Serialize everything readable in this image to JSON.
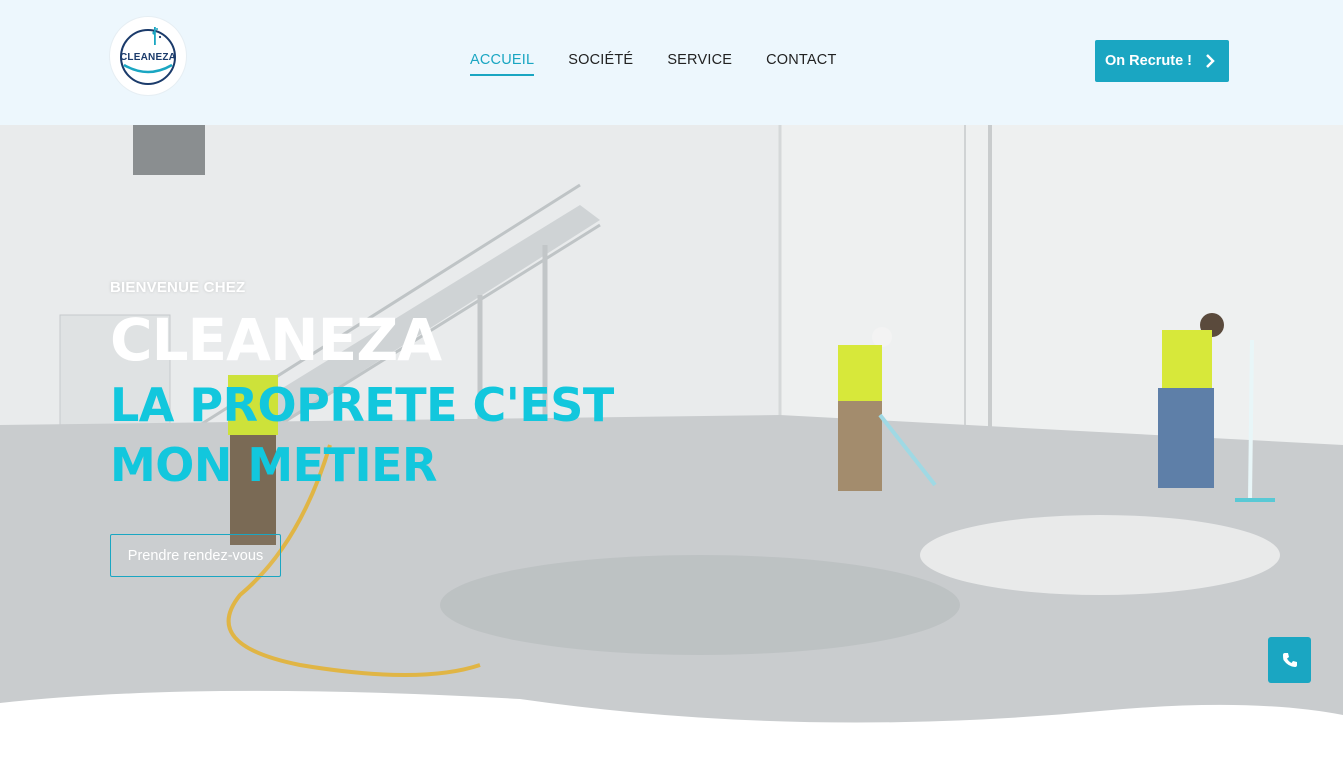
{
  "header": {
    "logo_text": "CLEANEZA",
    "nav": [
      {
        "label": "ACCUEIL",
        "active": true
      },
      {
        "label": "SOCIÉTÉ",
        "active": false
      },
      {
        "label": "SERVICE",
        "active": false
      },
      {
        "label": "CONTACT",
        "active": false
      }
    ],
    "recruit_label": "On Recrute !"
  },
  "hero": {
    "welcome": "BIENVENUE CHEZ",
    "brand": "CLEANEZA",
    "tagline": "LA PROPRETE C'EST MON METIER",
    "cta_label": "Prendre rendez-vous"
  },
  "floating": {
    "phone_icon": "phone-icon"
  },
  "colors": {
    "accent": "#1aa6c2",
    "tagline": "#12c7dd",
    "header_bg": "#edf7fd",
    "logo_navy": "#1b3b6b"
  }
}
